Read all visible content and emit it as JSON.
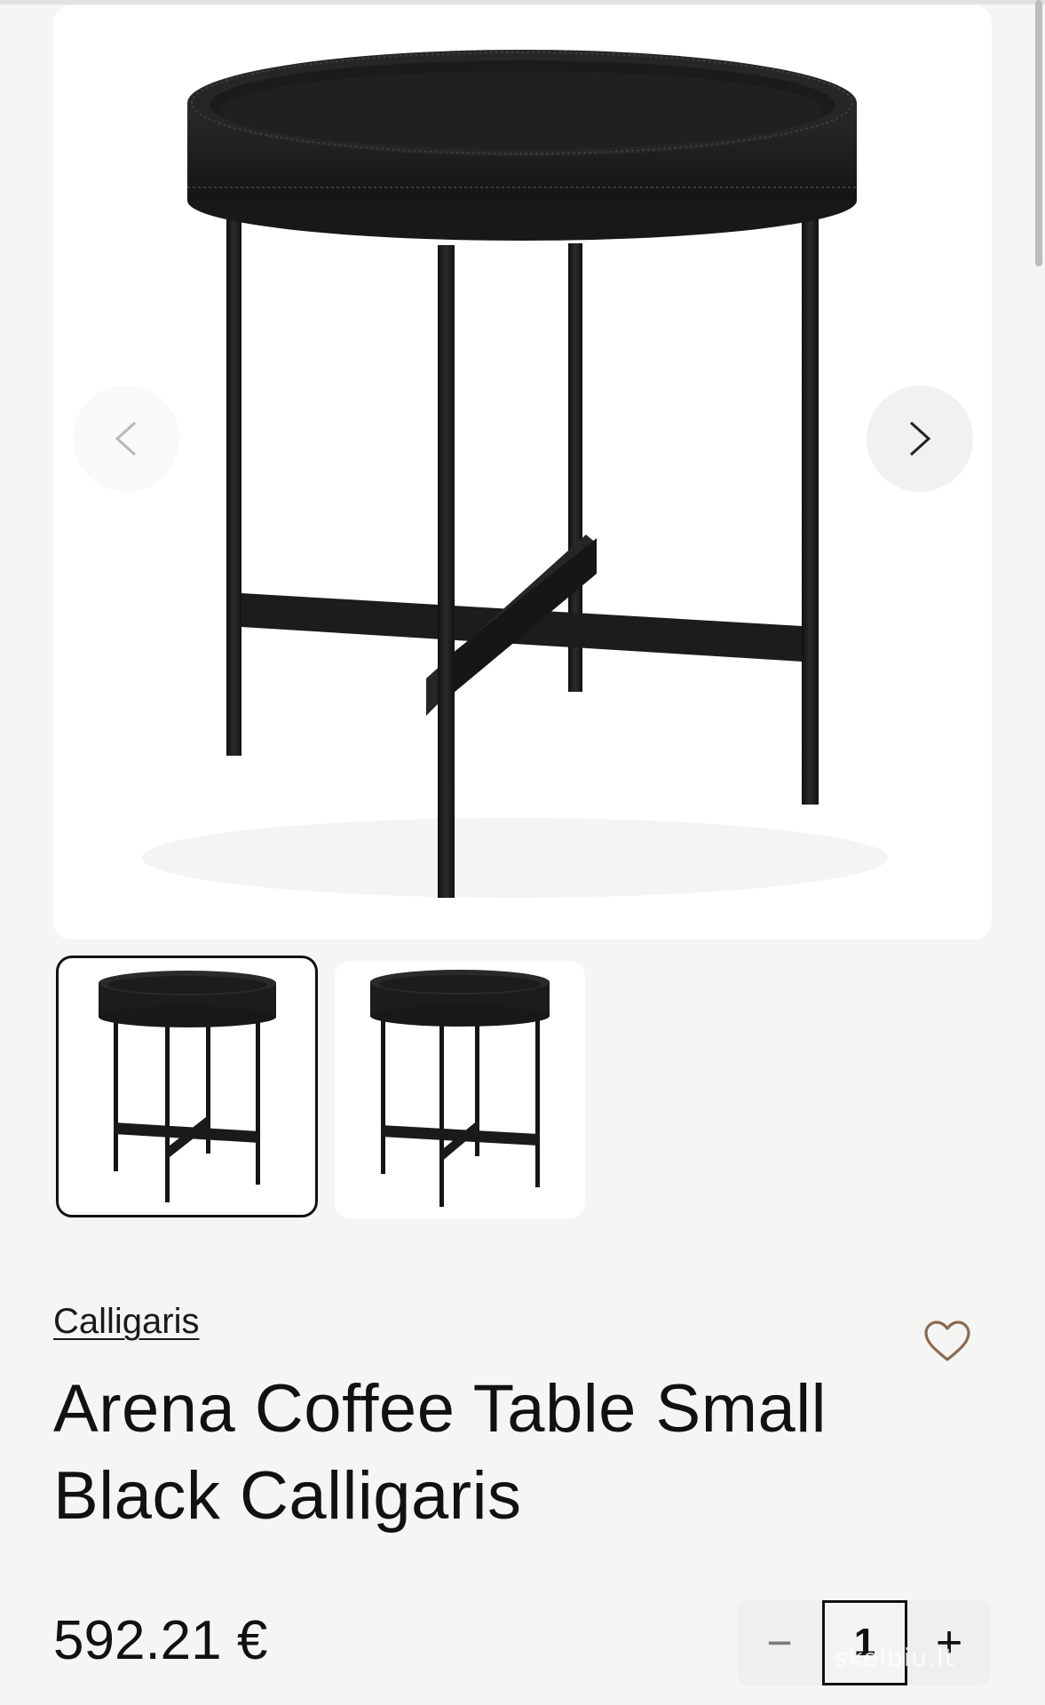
{
  "gallery": {
    "main_alt": "Arena Coffee Table Small Black Calligaris",
    "prev_icon": "chevron-left-icon",
    "next_icon": "chevron-right-icon",
    "thumbnails": [
      {
        "label": "thumbnail-1",
        "selected": true
      },
      {
        "label": "thumbnail-2",
        "selected": false
      }
    ]
  },
  "product": {
    "brand": "Calligaris",
    "title_line1": "Arena Coffee Table Small",
    "title_line2": "Black Calligaris",
    "price": "592.21 €",
    "wishlist_icon": "heart-icon"
  },
  "quantity": {
    "minus_label": "−",
    "value": "1",
    "plus_label": "+"
  },
  "watermark": "skelbiu.lt",
  "colors": {
    "background": "#f5f5f4",
    "table": "#151515",
    "heart": "#8a6a52"
  }
}
